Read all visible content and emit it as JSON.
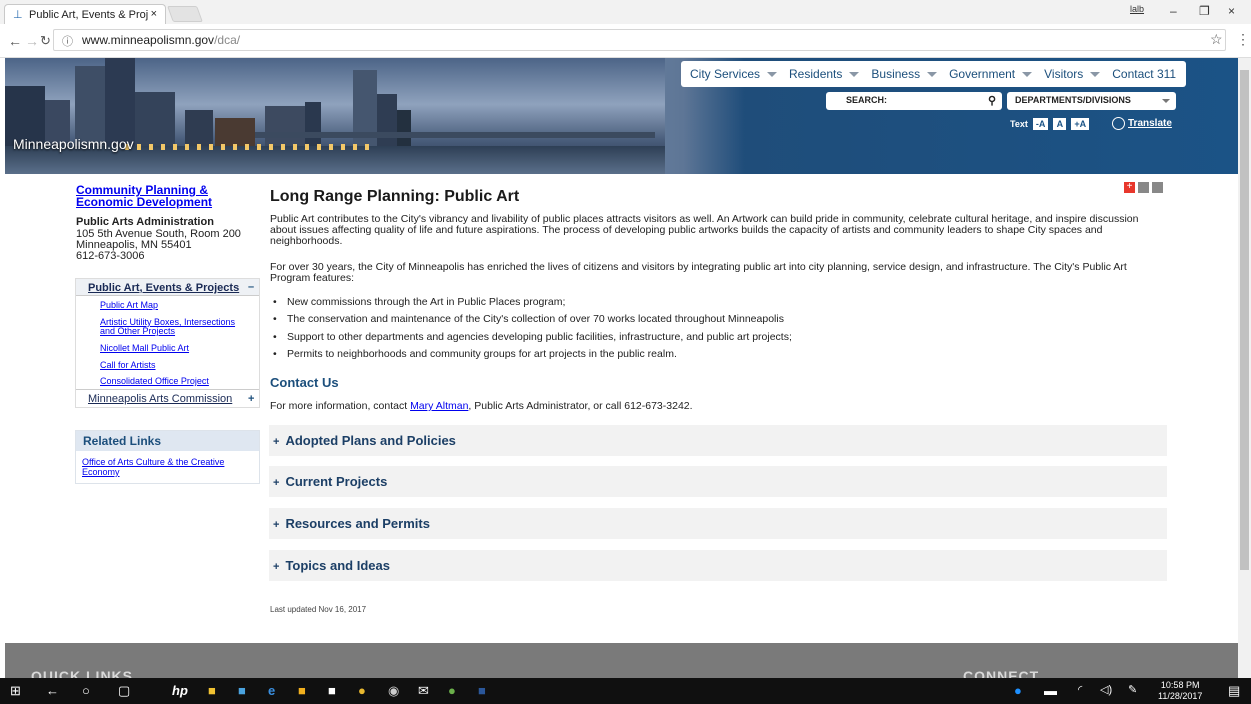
{
  "browser": {
    "tab_title": "Public Art, Events & Proj",
    "tab_close": "×",
    "url_host": "www.minneapolismn.gov",
    "url_path": "/dca/",
    "user_label": "lalb",
    "win_min": "–",
    "win_max": "❐",
    "win_close": "×"
  },
  "header": {
    "logo": "Minneapolismn.gov",
    "nav": [
      "City Services",
      "Residents",
      "Business",
      "Government",
      "Visitors",
      "Contact 311"
    ],
    "search_label": "SEARCH:",
    "departments": "DEPARTMENTS/DIVISIONS",
    "text_label": "Text",
    "text_sizes": [
      "-A",
      "A",
      "+A"
    ],
    "translate": "Translate"
  },
  "sidebar": {
    "org": "Community Planning & Economic Development",
    "office": "Public Arts Administration",
    "address": [
      "105 5th Avenue South, Room 200",
      "Minneapolis, MN 55401",
      "612-673-3006"
    ],
    "section": "Public Art, Events & Projects",
    "section_toggle": "–",
    "items": [
      "Public Art Map",
      "Artistic Utility Boxes, Intersections and Other Projects",
      "Nicollet Mall Public Art",
      "Call for Artists",
      "Consolidated Office Project"
    ],
    "commission": "Minneapolis Arts Commission",
    "commission_toggle": "+",
    "related_title": "Related Links",
    "related_link": "Office of Arts Culture & the Creative Economy"
  },
  "main": {
    "title": "Long Range Planning: Public Art",
    "p1": "Public Art contributes to the City's vibrancy and livability of public places attracts visitors as well. An Artwork can build pride in community, celebrate cultural heritage, and inspire discussion about issues affecting quality of life and future aspirations. The process of developing public artworks builds the capacity of artists and community leaders to shape City spaces and neighborhoods.",
    "p2": "For over 30 years, the City of Minneapolis has enriched the lives of citizens and visitors by integrating public art into city planning, service design, and infrastructure. The City's Public Art Program features:",
    "bullets": [
      "New commissions through the Art in Public Places program;",
      "The conservation and maintenance of the City's collection of over 70 works located throughout Minneapolis",
      "Support to other departments and agencies developing public facilities, infrastructure, and public art projects;",
      "Permits to neighborhoods and community groups for art projects in the public realm."
    ],
    "contact_heading": "Contact Us",
    "contact_pre": "For more information, contact ",
    "contact_name": "Mary Altman",
    "contact_post": ", Public Arts Administrator, or call 612-673-3242.",
    "accordions": [
      "Adopted Plans and Policies",
      "Current Projects",
      "Resources and Permits",
      "Topics and Ideas"
    ],
    "updated": "Last updated Nov 16, 2017"
  },
  "footer": {
    "left": "QUICK LINKS",
    "right": "CONNECT"
  },
  "taskbar": {
    "time": "10:58 PM",
    "date": "11/28/2017"
  },
  "colors": {
    "accent_blue": "#1b5386",
    "link": "#0000ee",
    "share_red": "#e8372c"
  }
}
